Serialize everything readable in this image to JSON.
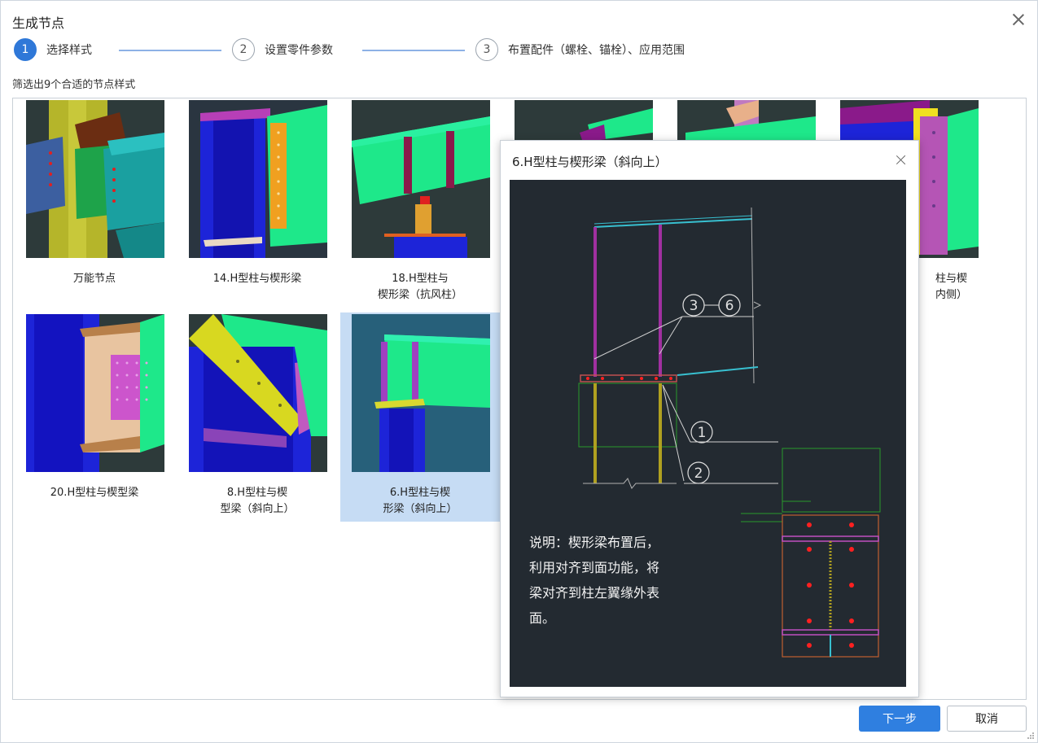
{
  "dialog": {
    "title": "生成节点"
  },
  "steps": [
    {
      "number": "1",
      "label": "选择样式",
      "active": true
    },
    {
      "number": "2",
      "label": "设置零件参数",
      "active": false
    },
    {
      "number": "3",
      "label": "布置配件（螺栓、锚栓）、应用范围",
      "active": false
    }
  ],
  "filter_label": "筛选出9个合适的节点样式",
  "cards": [
    {
      "caption_1": "万能节点",
      "caption_2": ""
    },
    {
      "caption_1": "14.H型柱与楔形梁",
      "caption_2": ""
    },
    {
      "caption_1": "18.H型柱与",
      "caption_2": "楔形梁（抗风柱）"
    },
    {
      "caption_1": "柱与楔",
      "caption_2": "内侧）"
    },
    {
      "caption_1": "20.H型柱与楔型梁",
      "caption_2": ""
    },
    {
      "caption_1": "8.H型柱与楔",
      "caption_2": "型梁（斜向上）"
    },
    {
      "caption_1": "6.H型柱与楔",
      "caption_2": "形梁（斜向上）"
    }
  ],
  "popup": {
    "title": "6.H型柱与楔形梁（斜向上）",
    "callout_a": "3",
    "callout_b": "6",
    "callout_1": "1",
    "callout_2": "2",
    "note_lines": [
      "说明：楔形梁布置后，",
      "利用对齐到面功能，将",
      "梁对齐到柱左翼缘外表",
      "面。"
    ]
  },
  "buttons": {
    "next": "下一步",
    "cancel": "取消"
  },
  "colors": {
    "accent": "#2f7fe0",
    "selected_card": "#c6dcf4",
    "popup_canvas": "#232a31"
  }
}
